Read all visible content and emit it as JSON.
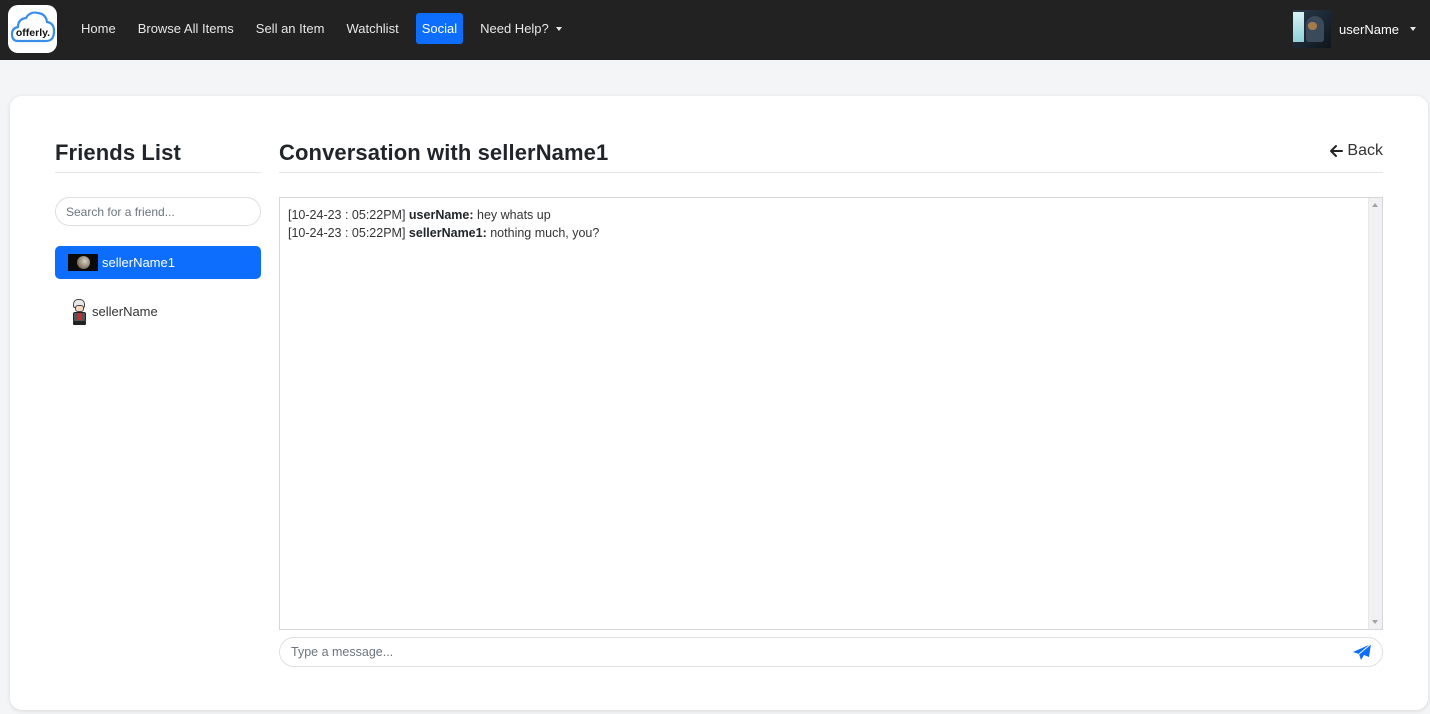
{
  "navbar": {
    "logo_text": "offerly.",
    "links": [
      {
        "label": "Home",
        "active": false
      },
      {
        "label": "Browse All Items",
        "active": false
      },
      {
        "label": "Sell an Item",
        "active": false
      },
      {
        "label": "Watchlist",
        "active": false
      },
      {
        "label": "Social",
        "active": true
      },
      {
        "label": "Need Help?",
        "active": false,
        "dropdown": true
      }
    ],
    "user": {
      "name": "userName",
      "avatar_icon": "user-avatar-image",
      "dropdown": true
    }
  },
  "friends": {
    "title": "Friends List",
    "search_placeholder": "Search for a friend...",
    "items": [
      {
        "name": "sellerName1",
        "avatar_icon": "planet-avatar",
        "active": true
      },
      {
        "name": "sellerName",
        "avatar_icon": "character-avatar",
        "active": false
      }
    ]
  },
  "conversation": {
    "title": "Conversation with sellerName1",
    "back_label": "Back",
    "back_icon": "arrow-left-icon",
    "messages": [
      {
        "timestamp": "[10-24-23 : 05:22PM]",
        "sender": "userName:",
        "text": "hey whats up"
      },
      {
        "timestamp": "[10-24-23 : 05:22PM]",
        "sender": "sellerName1:",
        "text": "nothing much, you?"
      }
    ],
    "input_placeholder": "Type a message...",
    "send_icon": "paper-plane-icon"
  },
  "colors": {
    "navbar_bg": "#222222",
    "accent": "#0d6efd",
    "page_bg": "#f4f5f7"
  }
}
